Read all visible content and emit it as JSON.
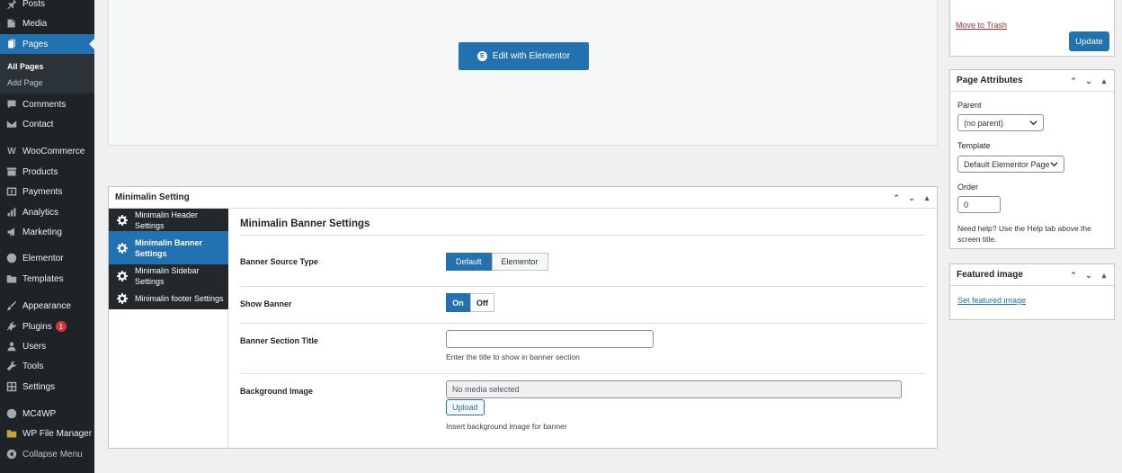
{
  "sidebar": {
    "items": [
      {
        "label": "Posts",
        "icon": "pin-icon"
      },
      {
        "label": "Media",
        "icon": "media-icon"
      },
      {
        "label": "Pages",
        "icon": "pages-icon"
      },
      {
        "label": "Comments",
        "icon": "comments-icon"
      },
      {
        "label": "Contact",
        "icon": "mail-icon"
      },
      {
        "label": "WooCommerce",
        "icon": "woo-icon"
      },
      {
        "label": "Products",
        "icon": "archive-icon"
      },
      {
        "label": "Payments",
        "icon": "payments-icon"
      },
      {
        "label": "Analytics",
        "icon": "analytics-icon"
      },
      {
        "label": "Marketing",
        "icon": "megaphone-icon"
      },
      {
        "label": "Elementor",
        "icon": "elementor-icon"
      },
      {
        "label": "Templates",
        "icon": "folder-icon"
      },
      {
        "label": "Appearance",
        "icon": "brush-icon"
      },
      {
        "label": "Plugins",
        "icon": "plugin-icon"
      },
      {
        "label": "Users",
        "icon": "users-icon"
      },
      {
        "label": "Tools",
        "icon": "wrench-icon"
      },
      {
        "label": "Settings",
        "icon": "settings-icon"
      },
      {
        "label": "MC4WP",
        "icon": "mc4wp-icon"
      },
      {
        "label": "WP File Manager",
        "icon": "file-manager-icon"
      },
      {
        "label": "Collapse Menu",
        "icon": "collapse-icon"
      }
    ],
    "submenu": [
      "All Pages",
      "Add Page"
    ],
    "plugins_badge": "1"
  },
  "editor": {
    "edit_button": "Edit with Elementor"
  },
  "minimalin": {
    "box_title": "Minimalin Setting",
    "tabs": [
      {
        "label": "Minimalin Header Settings"
      },
      {
        "label": "Minimalin Banner Settings"
      },
      {
        "label": "Minimalin Sidebar Settings"
      },
      {
        "label": "Minimalin footer Settings"
      }
    ],
    "section_title": "Minimalin Banner Settings",
    "banner_source": {
      "label": "Banner Source Type",
      "options": [
        "Default",
        "Elementor"
      ],
      "selected": "Default"
    },
    "show_banner": {
      "label": "Show Banner",
      "on": "On",
      "off": "Off",
      "selected": "On"
    },
    "section_title_field": {
      "label": "Banner Section Title",
      "value": "",
      "desc": "Enter the title to show in banner section"
    },
    "background": {
      "label": "Background Image",
      "value": "No media selected",
      "upload": "Upload",
      "desc": "Insert background image for banner"
    }
  },
  "publish": {
    "trash": "Move to Trash",
    "update": "Update"
  },
  "page_attributes": {
    "title": "Page Attributes",
    "parent_label": "Parent",
    "parent_value": "(no parent)",
    "template_label": "Template",
    "template_value": "Default Elementor Page",
    "order_label": "Order",
    "order_value": "0",
    "help": "Need help? Use the Help tab above the screen title."
  },
  "featured_image": {
    "title": "Featured image",
    "link": "Set featured image"
  },
  "colors": {
    "sidebar_bg": "#1d2327",
    "accent": "#2271b1",
    "danger": "#b32d2e"
  }
}
